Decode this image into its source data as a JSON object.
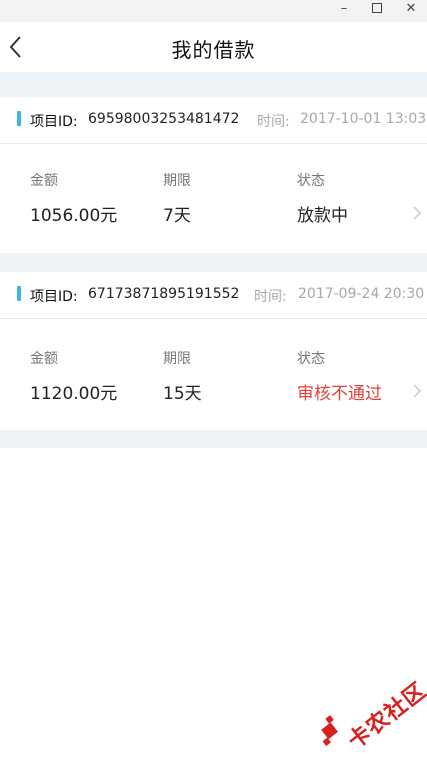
{
  "window": {
    "minimize_glyph": "–",
    "close_glyph": "✕"
  },
  "nav": {
    "title": "我的借款",
    "back_icon": "chevron-left-icon"
  },
  "loans": [
    {
      "id_label": "项目ID:",
      "id_value": "69598003253481472",
      "time_label": "时间:",
      "time_value": "2017-10-01 13:03",
      "amount_label": "金额",
      "amount_value": "1056.00元",
      "term_label": "期限",
      "term_value": "7天",
      "status_label": "状态",
      "status_value": "放款中",
      "status_color": "#222222"
    },
    {
      "id_label": "项目ID:",
      "id_value": "67173871895191552",
      "time_label": "时间:",
      "time_value": "2017-09-24 20:30",
      "amount_label": "金额",
      "amount_value": "1120.00元",
      "term_label": "期限",
      "term_value": "15天",
      "status_label": "状态",
      "status_value": "审核不通过",
      "status_color": "#e0413b"
    }
  ],
  "watermark": {
    "text": "卡农社区"
  },
  "colors": {
    "accent": "#3cb4f0",
    "background_gap": "#eef3f8",
    "status_rejected": "#e0413b"
  }
}
